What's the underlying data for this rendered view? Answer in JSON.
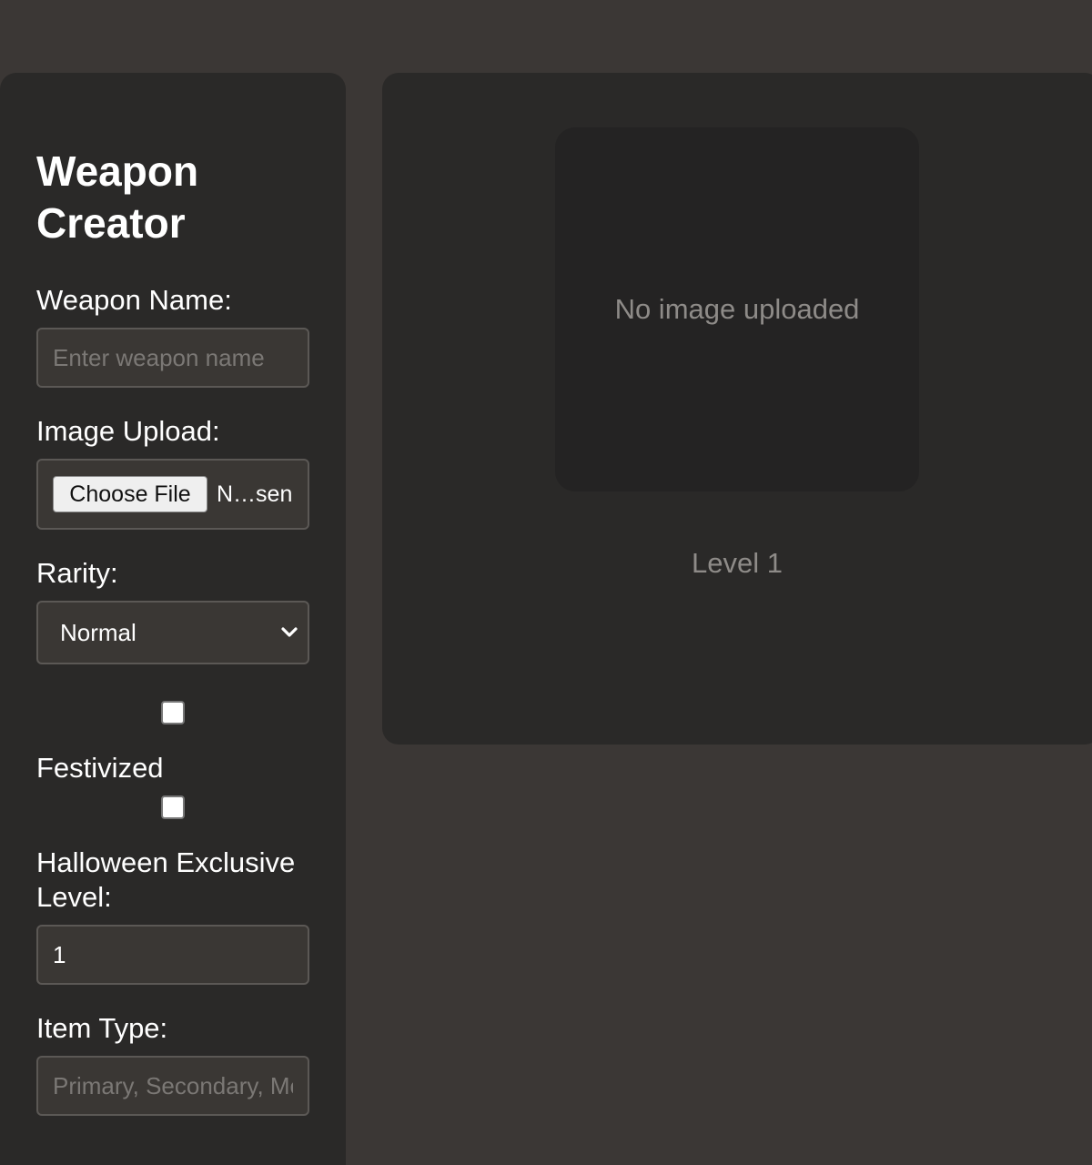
{
  "sidebar": {
    "title": "Weapon Creator",
    "weapon_name_label": "Weapon Name:",
    "weapon_name_placeholder": "Enter weapon name",
    "weapon_name_value": "",
    "image_upload_label": "Image Upload:",
    "choose_file_label": "Choose File",
    "file_status": "N…sen",
    "rarity_label": "Rarity:",
    "rarity_selected": "Normal",
    "festivized_label": "Festivized",
    "festivized_checked": false,
    "halloween_label": "Halloween Exclusive",
    "halloween_checked": false,
    "level_label": "Level:",
    "level_value": "1",
    "item_type_label": "Item Type:",
    "item_type_placeholder": "Primary, Secondary, Melee"
  },
  "preview": {
    "no_image_text": "No image uploaded",
    "level_text": "Level 1"
  },
  "colors": {
    "page_background": "#3b3735",
    "panel_background": "#2a2928",
    "image_box_background": "#242323",
    "field_background": "#3a3734",
    "field_border": "#5b5855",
    "muted_text": "#8e8b88"
  },
  "icons": {
    "rarity_dropdown": "chevron-down-icon"
  }
}
